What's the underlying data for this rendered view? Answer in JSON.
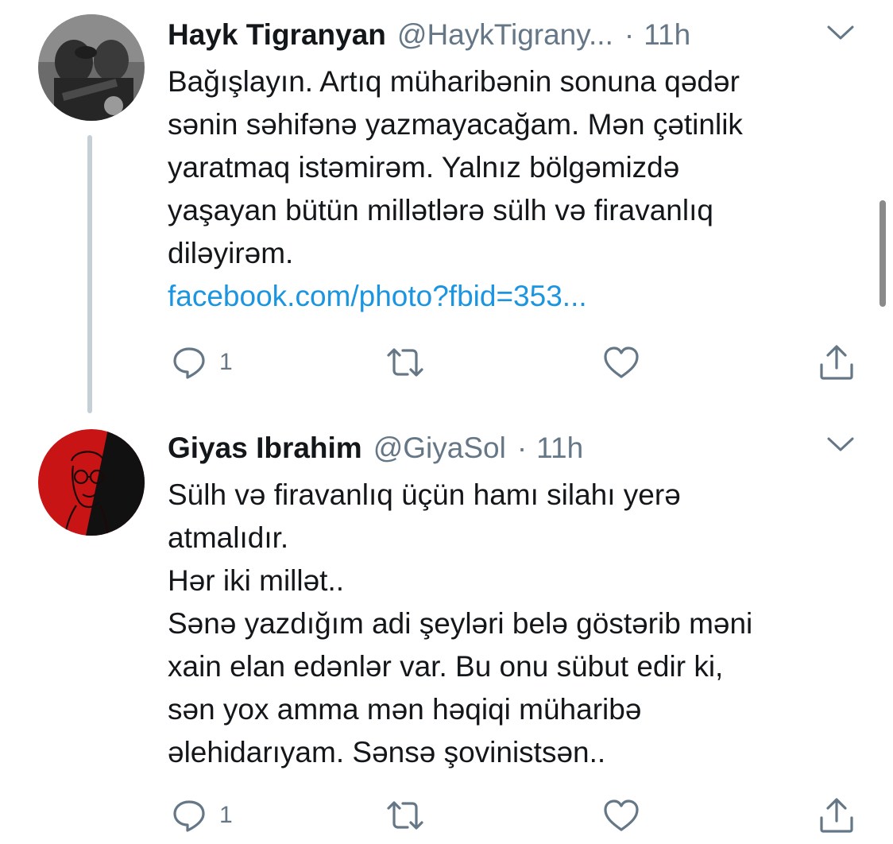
{
  "tweets": [
    {
      "author_name": "Hayk Tigranyan",
      "handle": "@HaykTigrany...",
      "separator": "·",
      "time": "11h",
      "text_lines": [
        "Bağışlayın. Artıq müharibənin sonuna qədər",
        "sənin səhifənə yazmayacağam. Mən çətinlik",
        "yaratmaq istəmirəm. Yalnız bölgəmizdə",
        "yaşayan bütün millətlərə sülh və firavanlıq",
        "diləyirəm."
      ],
      "link": "facebook.com/photo?fbid=353...",
      "reply_count": "1",
      "avatar_icon": "profile-photo"
    },
    {
      "author_name": "Giyas Ibrahim",
      "handle": "@GiyaSol",
      "separator": "·",
      "time": "11h",
      "text_lines": [
        "Sülh və firavanlıq üçün hamı silahı yerə",
        "atmalıdır.",
        "Hər iki millət..",
        "Sənə yazdığım adi şeyləri belə göstərib məni",
        "xain elan edənlər var. Bu onu sübut edir ki,",
        "sən yox amma mən həqiqi müharibə",
        "əlehidarıyam. Sənsə şovinistsən.."
      ],
      "reply_count": "1",
      "avatar_icon": "red-black-avatar"
    }
  ],
  "colors": {
    "name": "#14171a",
    "secondary": "#657786",
    "link": "#1b95e0",
    "thread_line": "#c4cfd6"
  },
  "icons": [
    "reply-icon",
    "retweet-icon",
    "like-icon",
    "share-icon",
    "chevron-down-icon"
  ]
}
